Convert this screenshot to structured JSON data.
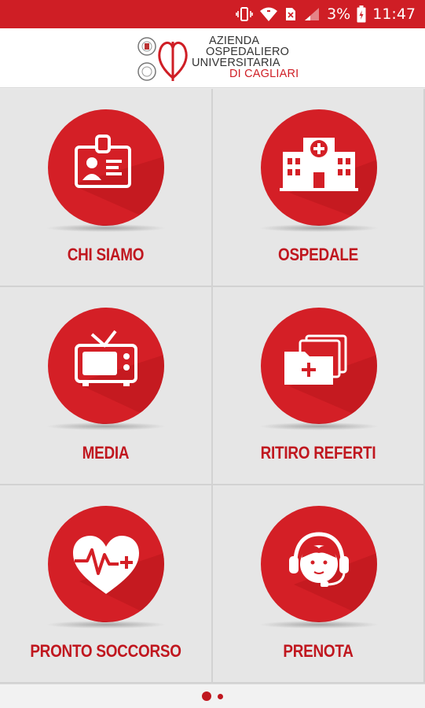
{
  "status_bar": {
    "battery_percent": "3%",
    "time": "11:47",
    "icons": [
      "vibrate-icon",
      "wifi-icon",
      "sim-icon",
      "signal-icon",
      "battery-icon"
    ]
  },
  "header": {
    "logo": {
      "line1": "Azienda",
      "line2": "Ospedaliero",
      "line3": "Universitaria",
      "line4": "di Cagliari"
    }
  },
  "menu": {
    "items": [
      {
        "label": "CHI SIAMO",
        "icon": "id-badge-icon"
      },
      {
        "label": "OSPEDALE",
        "icon": "hospital-icon"
      },
      {
        "label": "MEDIA",
        "icon": "tv-icon"
      },
      {
        "label": "RITIRO REFERTI",
        "icon": "medical-folder-icon"
      },
      {
        "label": "PRONTO SOCCORSO",
        "icon": "heart-pulse-icon"
      },
      {
        "label": "PRENOTA",
        "icon": "headset-operator-icon"
      }
    ]
  },
  "pager": {
    "pages": 2,
    "current_page": 1
  },
  "colors": {
    "accent": "#cf1e25",
    "tile_bg": "#e6e6e6",
    "label": "#c0171f"
  }
}
